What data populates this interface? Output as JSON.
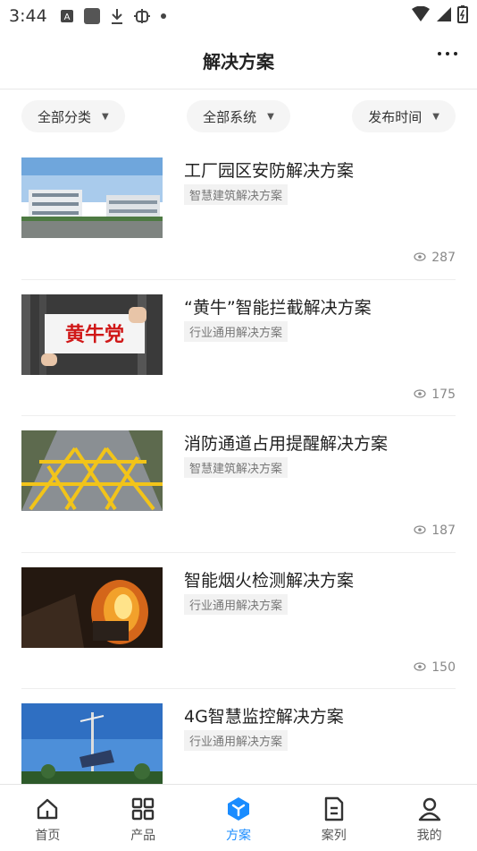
{
  "status_bar": {
    "time": "3:44"
  },
  "header": {
    "title": "解决方案"
  },
  "filters": [
    {
      "label": "全部分类"
    },
    {
      "label": "全部系统"
    },
    {
      "label": "发布时间"
    }
  ],
  "solutions": [
    {
      "title": "工厂园区安防解决方案",
      "tag": "智慧建筑解决方案",
      "views": "287",
      "image": "factory-park-photo"
    },
    {
      "title": "“黄牛”智能拦截解决方案",
      "tag": "行业通用解决方案",
      "views": "175",
      "image": "scalper-sign-photo",
      "image_text": "黄牛党"
    },
    {
      "title": "消防通道占用提醒解决方案",
      "tag": "智慧建筑解决方案",
      "views": "187",
      "image": "fire-lane-photo"
    },
    {
      "title": "智能烟火检测解决方案",
      "tag": "行业通用解决方案",
      "views": "150",
      "image": "fire-detection-photo"
    },
    {
      "title": "4G智慧监控解决方案",
      "tag": "行业通用解决方案",
      "views": "",
      "image": "monitoring-pole-photo"
    }
  ],
  "tabbar": [
    {
      "label": "首页",
      "icon": "home-icon"
    },
    {
      "label": "产品",
      "icon": "grid-icon"
    },
    {
      "label": "方案",
      "icon": "solution-icon",
      "active": true
    },
    {
      "label": "案列",
      "icon": "document-icon"
    },
    {
      "label": "我的",
      "icon": "user-icon"
    }
  ],
  "colors": {
    "accent": "#1a8cff",
    "text": "#222222",
    "muted": "#888888"
  }
}
